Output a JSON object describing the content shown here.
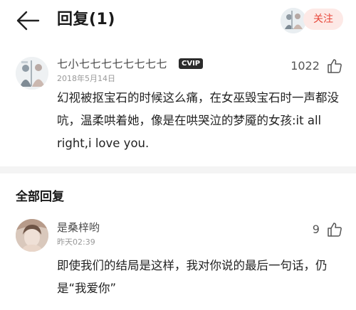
{
  "header": {
    "title": "回复(1)",
    "follow_label": "关注"
  },
  "original_comment": {
    "username": "七小七七七七七七七七",
    "badge": "CVIP",
    "date": "2018年5月14日",
    "likes": "1022",
    "body": "幻视被抠宝石的时候这么痛，在女巫毁宝石时一声都没吭，温柔哄着她，像是在哄哭泣的梦魇的女孩:it all right,i love you."
  },
  "section": {
    "title": "全部回复"
  },
  "reply": {
    "username": "是桑梓哟",
    "time": "昨天02:39",
    "likes": "9",
    "body": "即使我们的结局是这样，我对你说的最后一句话，仍是“我爱你”"
  },
  "icons": {
    "back": "back-arrow-icon",
    "like": "thumbs-up-icon"
  },
  "colors": {
    "accent": "#e8483b",
    "follow_bg": "#fde9e6",
    "divider": "#f4f4f4"
  }
}
